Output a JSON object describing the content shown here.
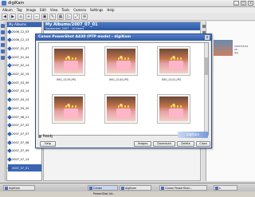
{
  "window": {
    "title": "digiKam"
  },
  "menubar": [
    "Album",
    "Tag",
    "Image",
    "Edit",
    "View",
    "Tools",
    "Camera",
    "Settings",
    "Help"
  ],
  "albums": {
    "header": "My Albums",
    "items": [
      "2006_12_03",
      "2006_12_13",
      "2007_01_07",
      "2007_01_04",
      "2007_02_14",
      "2007_02_19",
      "2007_03_09",
      "2007_03_14",
      "2007_04_14",
      "2007_05_20",
      "2007_06_21",
      "2007_07_02",
      "2007_07_07",
      "2007_07_08",
      "2007_07_09",
      "2007_07_14",
      "2007_07_01"
    ],
    "selected_index": 16,
    "footer": "2007_07_01"
  },
  "main": {
    "title": "My Albums/2007_07_01",
    "subtitle": "September 2007 - 10 items"
  },
  "right_panel": {
    "meta": [
      "2007/07/01",
      "20",
      "jpg"
    ]
  },
  "dialog": {
    "title": "Canon PowerShot A430 (PTP mode) - digiKam",
    "photos": [
      {
        "caption": "IMG_0139.JPG"
      },
      {
        "caption": "IMG_0140.JPG"
      },
      {
        "caption": "IMG_0141.JPG"
      },
      {
        "caption": ""
      },
      {
        "caption": ""
      },
      {
        "caption": ""
      }
    ],
    "status": "Ready",
    "logo": "digiKam",
    "buttons": {
      "help": "Help",
      "images": "Images",
      "download": "Download",
      "delete": "Delete",
      "close": "Close"
    }
  },
  "taskbar": {
    "items": [
      "digiKam",
      "Canon PowerShot A4...",
      "digiKam",
      "Canon PowerShot...",
      "s"
    ],
    "active_index": 1
  },
  "status_bar": "IMG_0139.JPG"
}
